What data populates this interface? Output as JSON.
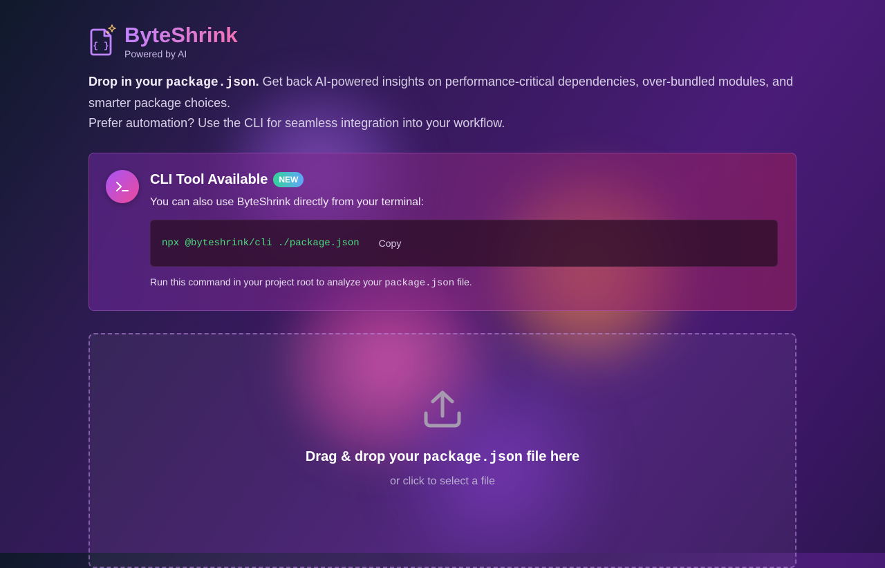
{
  "brand": {
    "name": "ByteShrink",
    "tagline": "Powered by AI"
  },
  "intro": {
    "lead_prefix": "Drop in your",
    "lead_code": "package.json",
    "lead_suffix": ".",
    "body": " Get back AI-powered insights on performance-critical dependencies, over-bundled modules, and smarter package choices.",
    "line2": "Prefer automation? Use the CLI for seamless integration into your workflow."
  },
  "cli": {
    "title": "CLI Tool Available",
    "badge": "NEW",
    "description": "You can also use ByteShrink directly from your terminal:",
    "command": "npx @byteshrink/cli ./package.json",
    "copy_label": "Copy",
    "note_prefix": "Run this command in your project root to analyze your",
    "note_code": "package.json",
    "note_suffix": "file."
  },
  "dropzone": {
    "title_prefix": "Drag & drop your",
    "title_code": "package.json",
    "title_suffix": "file here",
    "subtitle": "or click to select a file"
  },
  "colors": {
    "brand_gradient_start": "#c084fc",
    "brand_gradient_end": "#f472b6",
    "command_text": "#4ade80",
    "badge_start": "#34d399",
    "badge_end": "#60a5fa"
  },
  "icons": {
    "logo": "json-file-sparkle-icon",
    "cli": "terminal-prompt-icon",
    "upload": "upload-tray-icon"
  }
}
